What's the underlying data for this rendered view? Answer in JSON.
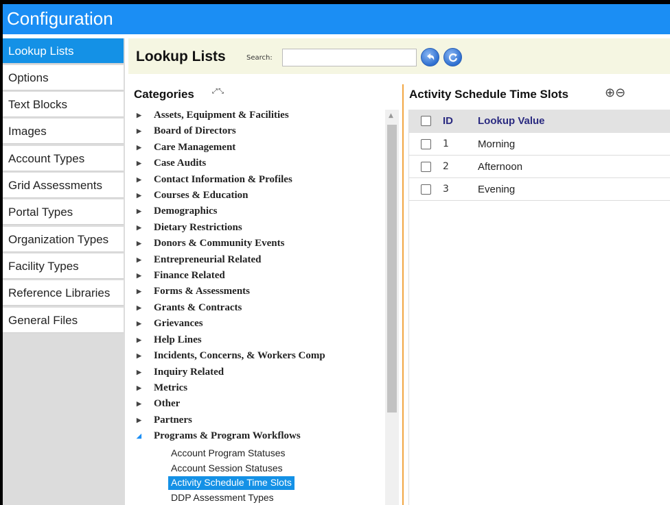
{
  "app": {
    "title": "Configuration"
  },
  "sidebar": {
    "items": [
      {
        "label": "Lookup Lists",
        "active": true
      },
      {
        "label": "Options"
      },
      {
        "label": "Text Blocks"
      },
      {
        "label": "Images"
      },
      {
        "label": "Account Types"
      },
      {
        "label": "Grid Assessments"
      },
      {
        "label": "Portal Types"
      },
      {
        "label": "Organization Types"
      },
      {
        "label": "Facility Types"
      },
      {
        "label": "Reference Libraries"
      },
      {
        "label": "General Files"
      }
    ]
  },
  "toolbar": {
    "heading": "Lookup Lists",
    "search_label": "Search:",
    "search_value": "",
    "back_icon": "undo-arrow-icon",
    "refresh_icon": "refresh-icon"
  },
  "categories": {
    "heading": "Categories",
    "items": [
      "Assets, Equipment & Facilities",
      "Board of Directors",
      "Care Management",
      "Case Audits",
      "Contact Information & Profiles",
      "Courses & Education",
      "Demographics",
      "Dietary Restrictions",
      "Donors & Community Events",
      "Entrepreneurial Related",
      "Finance Related",
      "Forms & Assessments",
      "Grants & Contracts",
      "Grievances",
      "Help Lines",
      "Incidents, Concerns, & Workers Comp",
      "Inquiry Related",
      "Metrics",
      "Other",
      "Partners",
      "Programs & Program Workflows"
    ],
    "open_children": [
      "Account Program Statuses",
      "Account Session Statuses",
      "Activity Schedule Time Slots",
      "DDP Assessment Types"
    ],
    "selected_child": "Activity Schedule Time Slots"
  },
  "detail": {
    "heading": "Activity Schedule Time Slots",
    "header": {
      "id": "ID",
      "value": "Lookup Value"
    },
    "rows": [
      {
        "id": "1",
        "value": "Morning"
      },
      {
        "id": "2",
        "value": "Afternoon"
      },
      {
        "id": "3",
        "value": "Evening"
      }
    ]
  },
  "colors": {
    "accent": "#1b8ef4",
    "selected": "#1491e6",
    "divider": "#f2a642",
    "toolbar_bg": "#f5f6e2"
  }
}
